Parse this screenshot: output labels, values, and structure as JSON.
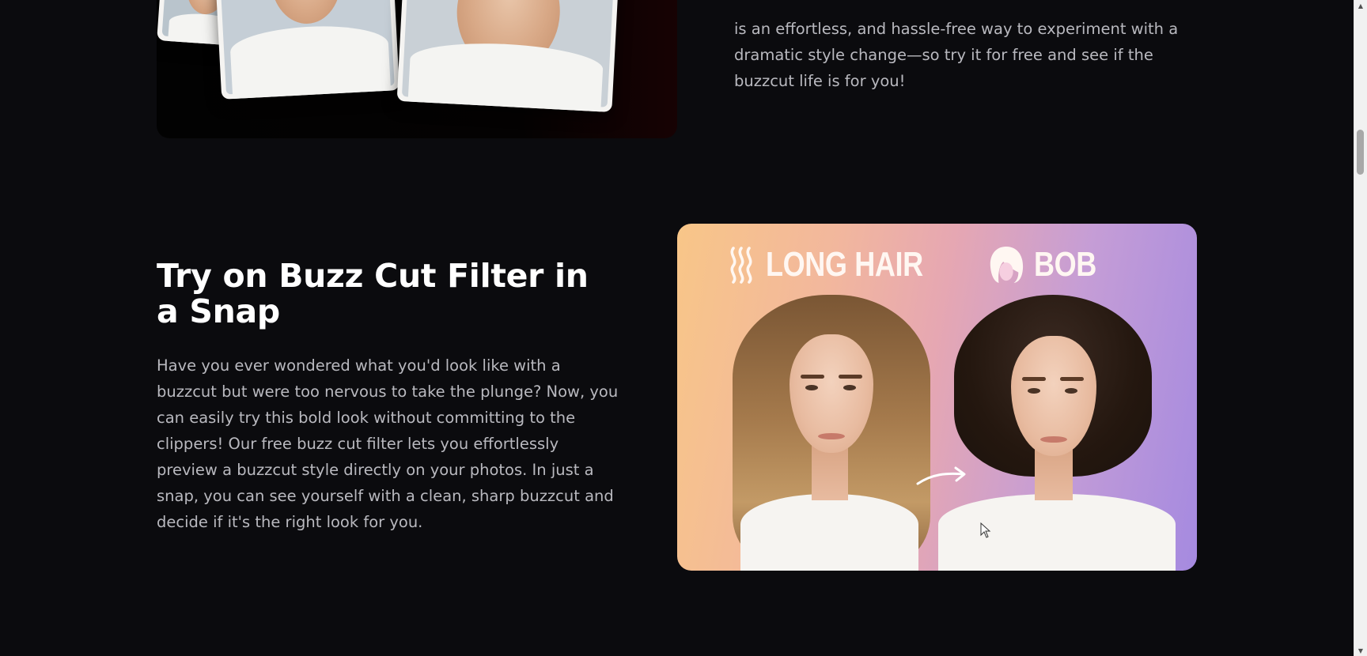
{
  "previous_section": {
    "paragraph_tail": "is an effortless, and hassle-free way to experiment with a dramatic style change—so try it for free and see if the buzzcut life is for you!"
  },
  "main_section": {
    "heading": "Try on Buzz Cut Filter in a Snap",
    "paragraph": "Have you ever wondered what you'd look like with a buzzcut but were too nervous to take the plunge? Now, you can easily try this bold look without committing to the clippers! Our free buzz cut filter lets you effortlessly preview a buzzcut style directly on your photos. In just a snap, you can see yourself with a clean, sharp buzzcut and decide if it's the right look for you."
  },
  "demo_image": {
    "before_label": "LONG HAIR",
    "before_icon": "wavy-hair-icon",
    "after_label": "BOB",
    "after_icon": "bob-hair-icon",
    "arrow_icon": "right-arrow-icon",
    "gradient_colors": [
      "#f8c688",
      "#e6a7b2",
      "#a58ae0"
    ]
  },
  "colors": {
    "background": "#0b0b0e",
    "heading": "#ffffff",
    "body_text": "#b9b9bf"
  }
}
